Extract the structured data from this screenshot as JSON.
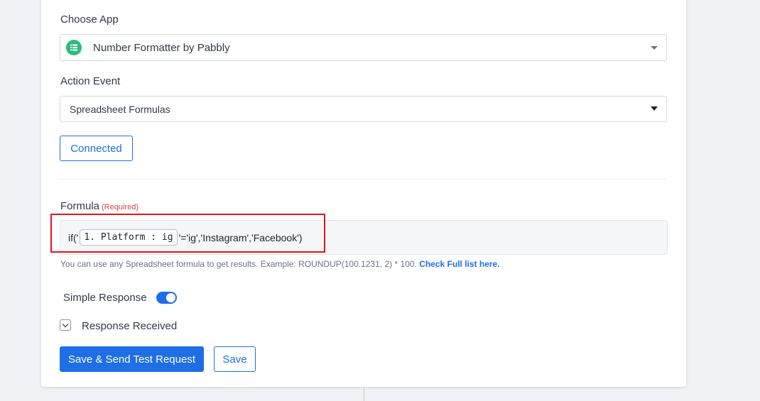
{
  "choose_app": {
    "label": "Choose App",
    "selected": "Number Formatter by Pabbly",
    "icon": "number-formatter-app-icon"
  },
  "action_event": {
    "label": "Action Event",
    "selected": "Spreadsheet Formulas"
  },
  "connection": {
    "button_label": "Connected"
  },
  "formula": {
    "label": "Formula",
    "required_text": "(Required)",
    "prefix": "if('",
    "token": "1. Platform : ig",
    "suffix": "'='ig','Instagram','Facebook')",
    "help_text": "You can use any Spreadsheet formula to get results. Example: ROUNDUP(100.1231, 2) * 100.",
    "help_link": "Check Full list here."
  },
  "simple_response": {
    "label": "Simple Response",
    "enabled": true
  },
  "response_received": {
    "label": "Response Received"
  },
  "actions": {
    "save_send_label": "Save & Send Test Request",
    "save_label": "Save"
  },
  "colors": {
    "primary": "#1e6ee6",
    "app_icon": "#2bbb7f",
    "highlight": "#e2131c",
    "required": "#d0454c"
  }
}
